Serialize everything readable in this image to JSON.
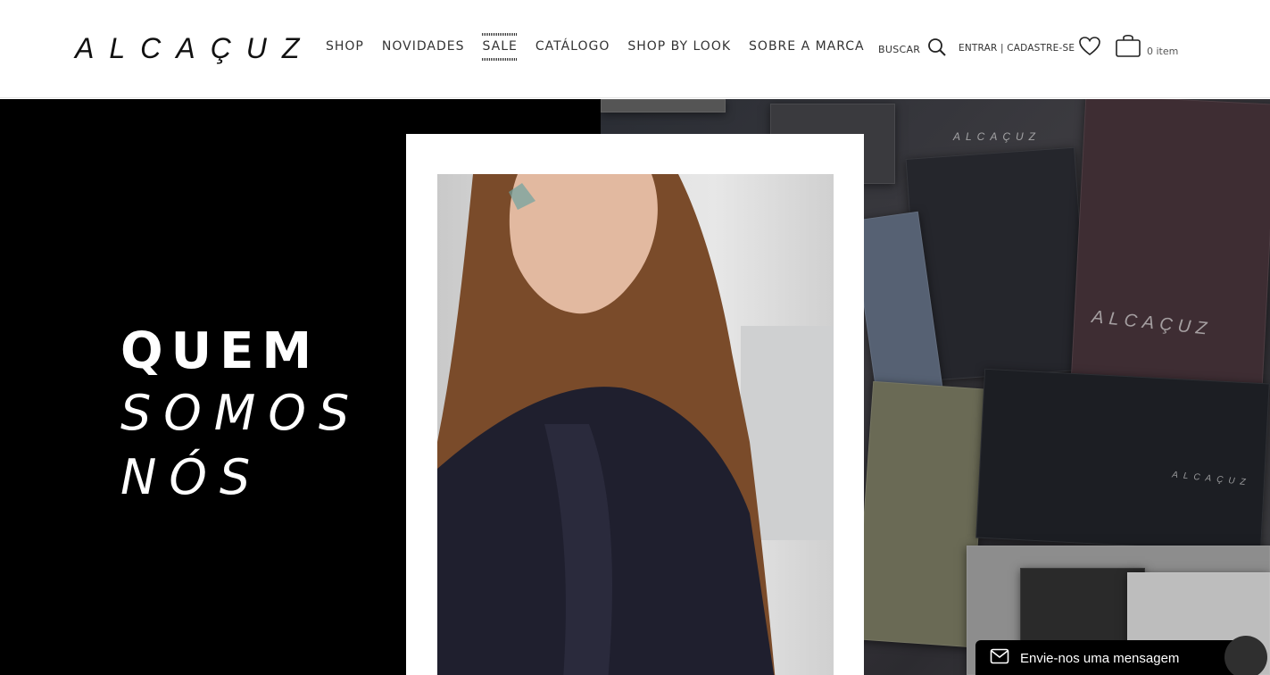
{
  "header": {
    "logo": "ALCAÇUZ",
    "nav": [
      "SHOP",
      "NOVIDADES",
      "SALE",
      "CATÁLOGO",
      "SHOP BY LOOK",
      "SOBRE A MARCA"
    ],
    "search_label": "BUSCAR",
    "account_label": "ENTRAR | CADASTRE-SE",
    "cart_count": "0 item"
  },
  "hero": {
    "title_line1": "QUEM",
    "title_line2": "SOMOS",
    "title_line3": "NÓS",
    "collage_brand": "ALCAÇUZ"
  },
  "chat": {
    "label": "Envie-nos uma mensagem"
  },
  "colors": {
    "hero_bg": "#000000",
    "header_bg": "#ffffff",
    "chat_bg": "#000000"
  },
  "icons": [
    "search-icon",
    "heart-icon",
    "shopping-bag-icon",
    "mail-icon"
  ]
}
